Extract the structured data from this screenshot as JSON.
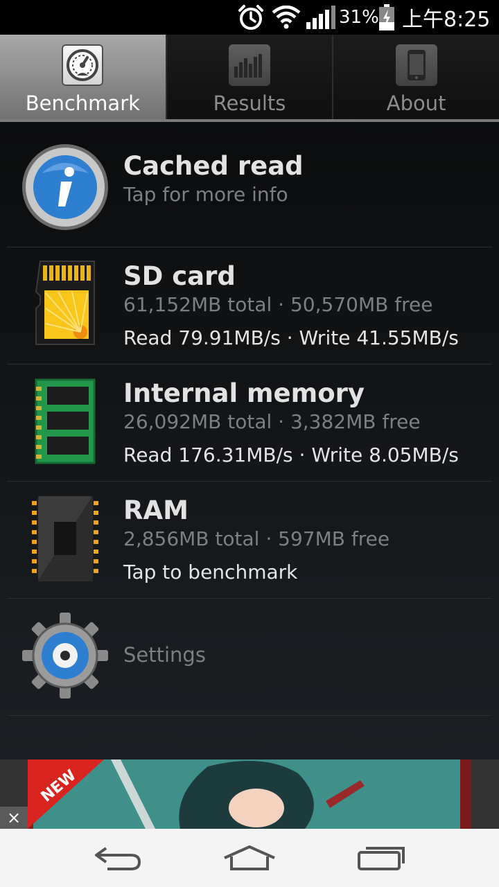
{
  "status_bar": {
    "battery_percent": "31%",
    "time": "上午8:25",
    "icons": [
      "alarm-clock-icon",
      "wifi-icon",
      "signal-icon",
      "battery-charging-icon"
    ]
  },
  "tabs": [
    {
      "label": "Benchmark",
      "icon": "speedometer-icon",
      "active": true
    },
    {
      "label": "Results",
      "icon": "bar-chart-icon",
      "active": false
    },
    {
      "label": "About",
      "icon": "phone-icon",
      "active": false
    }
  ],
  "rows": {
    "cached": {
      "title": "Cached read",
      "subtitle": "Tap for more info",
      "icon": "info-icon"
    },
    "sdcard": {
      "title": "SD card",
      "subtitle": "61,152MB total · 50,570MB free",
      "line3": "Read 79.91MB/s · Write 41.55MB/s",
      "icon": "sd-card-icon"
    },
    "internal": {
      "title": "Internal memory",
      "subtitle": "26,092MB total · 3,382MB free",
      "line3": "Read 176.31MB/s · Write 8.05MB/s",
      "icon": "memory-module-icon"
    },
    "ram": {
      "title": "RAM",
      "subtitle": "2,856MB total · 597MB free",
      "line3": "Tap to benchmark",
      "icon": "chip-icon"
    },
    "settings": {
      "label": "Settings",
      "icon": "gear-icon"
    }
  },
  "ad": {
    "badge": "NEW",
    "close_label": "×"
  },
  "nav": {
    "icons": [
      "back-icon",
      "home-icon",
      "recent-apps-icon"
    ]
  },
  "colors": {
    "background": "#1a1d21",
    "title": "#e2e2e2",
    "subtitle": "#7d7f82",
    "info_blue": "#2f7fd1"
  }
}
